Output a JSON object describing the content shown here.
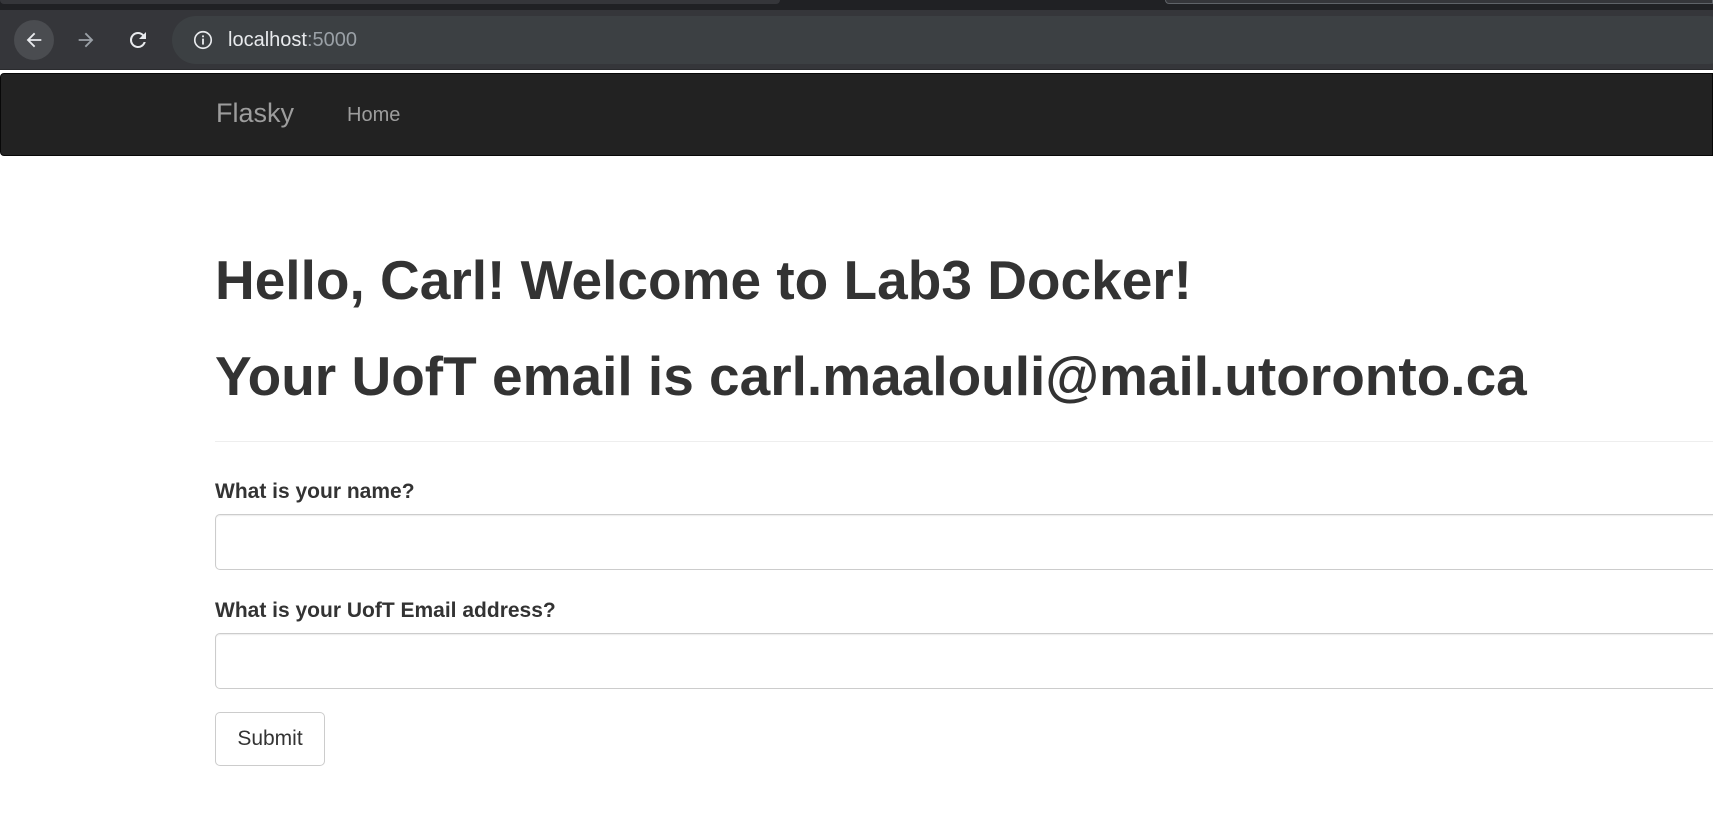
{
  "browser": {
    "url_host": "localhost",
    "url_port": ":5000",
    "icons": {
      "back": "back-arrow-icon",
      "forward": "forward-arrow-icon",
      "reload": "reload-icon",
      "site_info": "info-icon"
    }
  },
  "navbar": {
    "brand": "Flasky",
    "items": [
      {
        "label": "Home"
      }
    ],
    "background_color": "#222222",
    "text_color": "#9d9d9d"
  },
  "page": {
    "greeting": "Hello, Carl! Welcome to Lab3 Docker!",
    "email_line": "Your UofT email is carl.maalouli@mail.utoronto.ca"
  },
  "form": {
    "name_label": "What is your name?",
    "name_value": "",
    "email_label": "What is your UofT Email address?",
    "email_value": "",
    "submit_label": "Submit"
  }
}
